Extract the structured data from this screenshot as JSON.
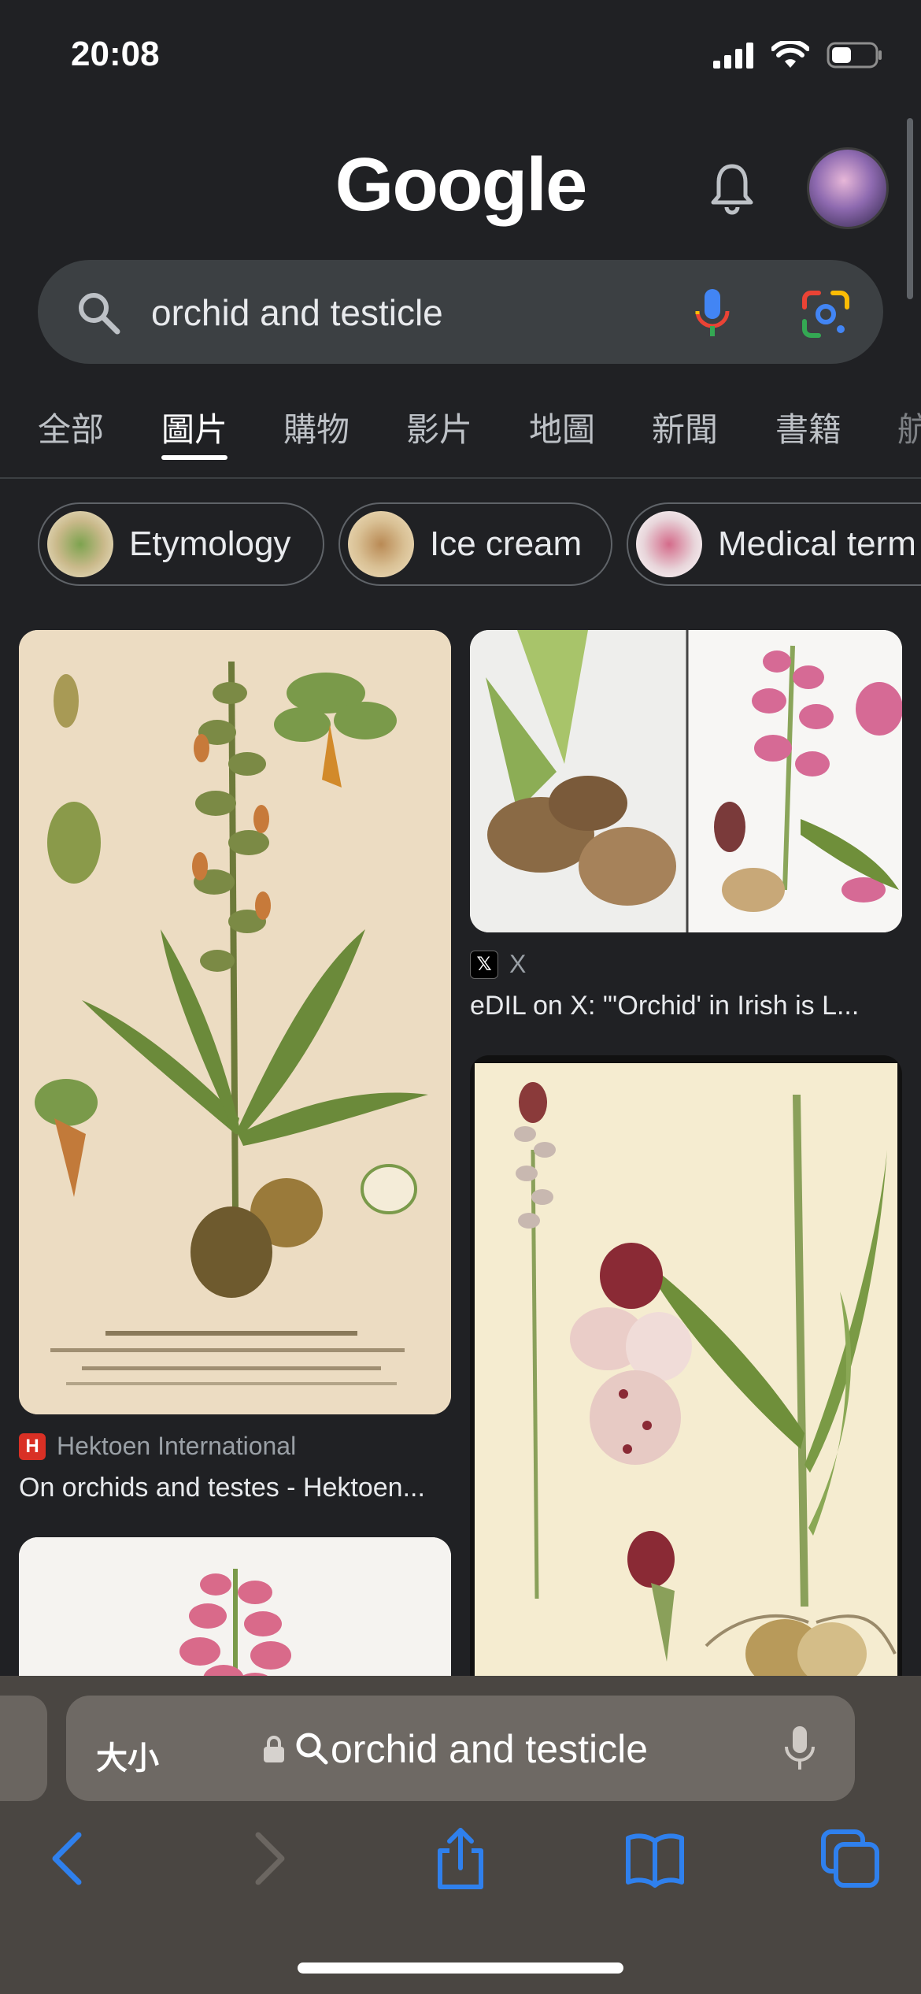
{
  "status_bar": {
    "time": "20:08"
  },
  "header": {
    "logo_text": "Google"
  },
  "search": {
    "query": "orchid and testicle"
  },
  "tabs": [
    {
      "label": "全部"
    },
    {
      "label": "圖片"
    },
    {
      "label": "購物"
    },
    {
      "label": "影片"
    },
    {
      "label": "地圖"
    },
    {
      "label": "新聞"
    },
    {
      "label": "書籍"
    },
    {
      "label": "航"
    }
  ],
  "active_tab": "圖片",
  "chips": [
    {
      "label": "Etymology"
    },
    {
      "label": "Ice cream"
    },
    {
      "label": "Medical term"
    }
  ],
  "results": [
    {
      "source": "Hektoen International",
      "title": "On orchids and testes - Hektoen..."
    },
    {
      "source": "X",
      "title": "eDIL on X: \"'Orchid' in Irish is L..."
    }
  ],
  "safari": {
    "text_size_label": "大小",
    "url_text": "orchid and testicle"
  },
  "colors": {
    "background": "#202124",
    "search_bar": "#3c4043",
    "hektoen_red": "#d93025",
    "safari_blue": "#2f80ed"
  }
}
